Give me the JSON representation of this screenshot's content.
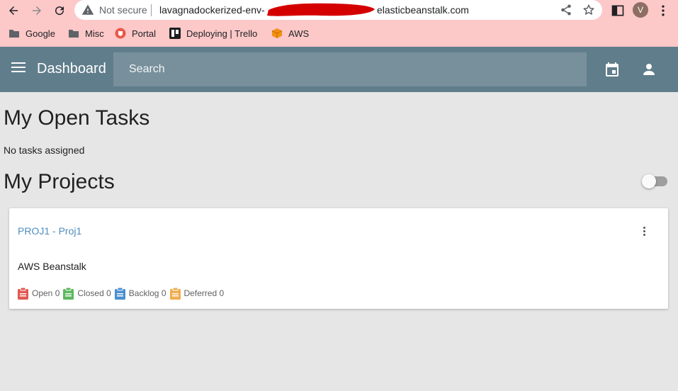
{
  "browser": {
    "security_label": "Not secure",
    "url_start": "lavagnadockerized-env-",
    "url_end": "elasticbeanstalk.com",
    "avatar_letter": "V",
    "bookmarks": [
      {
        "label": "Google",
        "icon": "folder-icon"
      },
      {
        "label": "Misc",
        "icon": "folder-icon"
      },
      {
        "label": "Portal",
        "icon": "portal-icon"
      },
      {
        "label": "Deploying | Trello",
        "icon": "trello-icon"
      },
      {
        "label": "AWS",
        "icon": "aws-cube-icon"
      }
    ]
  },
  "header": {
    "title": "Dashboard",
    "search_placeholder": "Search",
    "background_color": "#607d8b"
  },
  "tasks": {
    "heading": "My Open Tasks",
    "empty_text": "No tasks assigned"
  },
  "projects": {
    "heading": "My Projects",
    "toggle_on": false,
    "items": [
      {
        "title": "PROJ1 - Proj1",
        "description": "AWS Beanstalk",
        "stats": [
          {
            "label": "Open",
            "count": "0",
            "color": "#e05a52"
          },
          {
            "label": "Closed",
            "count": "0",
            "color": "#5cb85c"
          },
          {
            "label": "Backlog",
            "count": "0",
            "color": "#4a8fd0"
          },
          {
            "label": "Deferred",
            "count": "0",
            "color": "#f0ad4e"
          }
        ]
      }
    ]
  }
}
